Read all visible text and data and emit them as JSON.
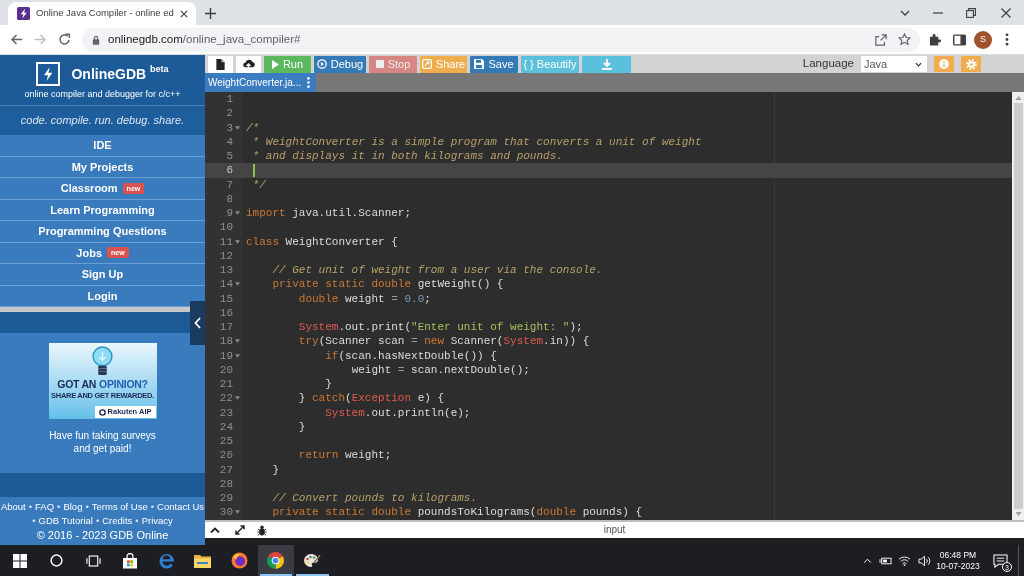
{
  "browser": {
    "tab_title": "Online Java Compiler - online ed",
    "url_host": "onlinegdb.com",
    "url_path": "/online_java_compiler#",
    "profile_initial": "S"
  },
  "sidebar": {
    "brand": "OnlineGDB $^{beta}$",
    "subtitle": "online compiler and debugger for c/c++",
    "tagline": "code. compile. run. debug. share.",
    "menu": [
      {
        "label": "IDE"
      },
      {
        "label": "My Projects"
      },
      {
        "label": "Classroom",
        "badge": "new"
      },
      {
        "label": "Learn Programming"
      },
      {
        "label": "Programming Questions"
      },
      {
        "label": "Jobs",
        "badge": "new"
      },
      {
        "label": "Sign Up"
      },
      {
        "label": "Login"
      }
    ],
    "ad": {
      "headline": "GOT AN",
      "headline_accent": "OPINION?",
      "subline": "SHARE AND GET REWARDED.",
      "brand": "Rakuten AIP",
      "caption": "Have fun taking surveys and get paid!"
    },
    "footer_rows": [
      [
        {
          "kind": "link",
          "text": "About"
        },
        {
          "kind": "separator",
          "text": "•"
        },
        {
          "kind": "link",
          "text": "FAQ"
        },
        {
          "kind": "separator",
          "text": "•"
        },
        {
          "kind": "link",
          "text": "Blog"
        },
        {
          "kind": "separator",
          "text": "•"
        },
        {
          "kind": "link",
          "text": "Terms of Use"
        },
        {
          "kind": "separator",
          "text": "•"
        },
        {
          "kind": "link",
          "text": "Contact Us"
        }
      ],
      [
        {
          "kind": "separator",
          "text": "•"
        },
        {
          "kind": "link",
          "text": "GDB Tutorial"
        },
        {
          "kind": "separator",
          "text": "•"
        },
        {
          "kind": "link",
          "text": "Credits"
        },
        {
          "kind": "separator",
          "text": "•"
        },
        {
          "kind": "link",
          "text": "Privacy"
        }
      ]
    ],
    "copyright": "© 2016 - 2023 GDB Online"
  },
  "toolbar": {
    "buttons": [
      {
        "kind": "new-file",
        "disabled": false
      },
      {
        "kind": "upload",
        "disabled": false
      },
      {
        "kind": "run",
        "label": "Run",
        "disabled": false
      },
      {
        "kind": "debug",
        "label": "Debug",
        "disabled": false
      },
      {
        "kind": "stop",
        "label": "Stop",
        "disabled": true
      },
      {
        "kind": "share",
        "label": "Share",
        "disabled": false
      },
      {
        "kind": "save",
        "label": "Save",
        "disabled": false
      },
      {
        "kind": "beautify",
        "label": "{ } Beautify",
        "disabled": false
      },
      {
        "kind": "download",
        "disabled": false
      }
    ],
    "language_label": "Language",
    "language": "Java"
  },
  "file_tabs": [
    {
      "label": "WeightConverter.ja...",
      "selected": true
    }
  ],
  "editor": {
    "lines": [
      {
        "number": "1",
        "foldable": false,
        "active": false
      },
      {
        "number": "2",
        "foldable": false,
        "active": false
      },
      {
        "number": "3",
        "foldable": true,
        "active": false,
        "tokens": [
          {
            "kind": "comment",
            "text": "/*"
          }
        ]
      },
      {
        "number": "4",
        "foldable": false,
        "active": false,
        "tokens": [
          {
            "kind": "comment",
            "text": " * WeightConverter is a simple program that converts a unit of weight"
          }
        ]
      },
      {
        "number": "5",
        "foldable": false,
        "active": false,
        "tokens": [
          {
            "kind": "comment",
            "text": " * and displays it in both kilograms and pounds."
          }
        ]
      },
      {
        "number": "6",
        "foldable": false,
        "active": true
      },
      {
        "number": "7",
        "foldable": false,
        "active": false,
        "tokens": [
          {
            "kind": "comment",
            "text": " */"
          }
        ]
      },
      {
        "number": "8",
        "foldable": false,
        "active": false
      },
      {
        "number": "9",
        "foldable": true,
        "active": false,
        "tokens": [
          {
            "kind": "keyword",
            "text": "import"
          },
          {
            "kind": "plain",
            "text": " java.util.Scanner;"
          }
        ]
      },
      {
        "number": "10",
        "foldable": false,
        "active": false
      },
      {
        "number": "11",
        "foldable": true,
        "active": false,
        "tokens": [
          {
            "kind": "keyword",
            "text": "class"
          },
          {
            "kind": "plain",
            "text": " WeightConverter {"
          }
        ]
      },
      {
        "number": "12",
        "foldable": false,
        "active": false
      },
      {
        "number": "13",
        "foldable": false,
        "active": false,
        "tokens": [
          {
            "kind": "comment",
            "text": "    // Get unit of weight from a user via the console."
          }
        ]
      },
      {
        "number": "14",
        "foldable": true,
        "active": false,
        "tokens": [
          {
            "kind": "keyword",
            "text": "    private static double"
          },
          {
            "kind": "plain",
            "text": " getWeight() {"
          }
        ]
      },
      {
        "number": "15",
        "foldable": false,
        "active": false,
        "tokens": [
          {
            "kind": "keyword",
            "text": "        double"
          },
          {
            "kind": "plain",
            "text": " weight "
          },
          {
            "kind": "operator",
            "text": "="
          },
          {
            "kind": "number",
            "text": " 0.0"
          },
          {
            "kind": "plain",
            "text": ";"
          }
        ]
      },
      {
        "number": "16",
        "foldable": false,
        "active": false
      },
      {
        "number": "17",
        "foldable": false,
        "active": false,
        "tokens": [
          {
            "kind": "type",
            "text": "        System"
          },
          {
            "kind": "plain",
            "text": ".out.print("
          },
          {
            "kind": "string",
            "text": "\"Enter unit of weight: \""
          },
          {
            "kind": "plain",
            "text": ");"
          }
        ]
      },
      {
        "number": "18",
        "foldable": true,
        "active": false,
        "tokens": [
          {
            "kind": "keyword",
            "text": "        try"
          },
          {
            "kind": "plain",
            "text": "(Scanner scan "
          },
          {
            "kind": "operator",
            "text": "="
          },
          {
            "kind": "keyword",
            "text": " new"
          },
          {
            "kind": "plain",
            "text": " Scanner("
          },
          {
            "kind": "type",
            "text": "System"
          },
          {
            "kind": "plain",
            "text": ".in)) {"
          }
        ]
      },
      {
        "number": "19",
        "foldable": true,
        "active": false,
        "tokens": [
          {
            "kind": "keyword",
            "text": "            if"
          },
          {
            "kind": "plain",
            "text": "(scan.hasNextDouble()) {"
          }
        ]
      },
      {
        "number": "20",
        "foldable": false,
        "active": false,
        "tokens": [
          {
            "kind": "plain",
            "text": "                weight "
          },
          {
            "kind": "operator",
            "text": "="
          },
          {
            "kind": "plain",
            "text": " scan.nextDouble();"
          }
        ]
      },
      {
        "number": "21",
        "foldable": false,
        "active": false,
        "tokens": [
          {
            "kind": "plain",
            "text": "            }"
          }
        ]
      },
      {
        "number": "22",
        "foldable": true,
        "active": false,
        "tokens": [
          {
            "kind": "plain",
            "text": "        } "
          },
          {
            "kind": "keyword",
            "text": "catch"
          },
          {
            "kind": "plain",
            "text": "("
          },
          {
            "kind": "type",
            "text": "Exception"
          },
          {
            "kind": "plain",
            "text": " e) {"
          }
        ]
      },
      {
        "number": "23",
        "foldable": false,
        "active": false,
        "tokens": [
          {
            "kind": "type",
            "text": "            System"
          },
          {
            "kind": "plain",
            "text": ".out.println(e);"
          }
        ]
      },
      {
        "number": "24",
        "foldable": false,
        "active": false,
        "tokens": [
          {
            "kind": "plain",
            "text": "        }"
          }
        ]
      },
      {
        "number": "25",
        "foldable": false,
        "active": false
      },
      {
        "number": "26",
        "foldable": false,
        "active": false,
        "tokens": [
          {
            "kind": "keyword",
            "text": "        return"
          },
          {
            "kind": "plain",
            "text": " weight;"
          }
        ]
      },
      {
        "number": "27",
        "foldable": false,
        "active": false,
        "tokens": [
          {
            "kind": "plain",
            "text": "    }"
          }
        ]
      },
      {
        "number": "28",
        "foldable": false,
        "active": false
      },
      {
        "number": "29",
        "foldable": false,
        "active": false,
        "tokens": [
          {
            "kind": "comment",
            "text": "    // Convert pounds to kilograms."
          }
        ]
      },
      {
        "number": "30",
        "foldable": true,
        "active": false,
        "tokens": [
          {
            "kind": "keyword",
            "text": "    private static double"
          },
          {
            "kind": "plain",
            "text": " poundsToKilograms("
          },
          {
            "kind": "keyword",
            "text": "double"
          },
          {
            "kind": "plain",
            "text": " pounds) {"
          }
        ]
      }
    ]
  },
  "bottom_panel": {
    "label": "input"
  },
  "taskbar": {
    "apps": [
      {
        "kind": "store",
        "running": false,
        "active": false
      },
      {
        "kind": "e-browser",
        "running": false,
        "active": false
      },
      {
        "kind": "folder",
        "running": false,
        "active": false
      },
      {
        "kind": "fox-browser",
        "running": false,
        "active": false
      },
      {
        "kind": "circle-browser",
        "running": true,
        "active": true
      },
      {
        "kind": "paint",
        "running": true,
        "active": false
      }
    ],
    "time": "06:48 PM",
    "date": "10-07-2023",
    "notification_count": "3"
  }
}
